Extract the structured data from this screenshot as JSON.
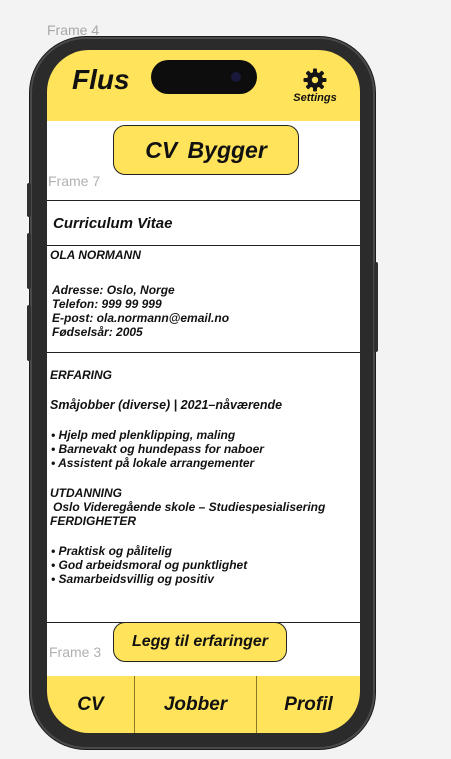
{
  "canvas": {
    "frame_top": "Frame 4"
  },
  "app": {
    "title": "Flus",
    "settings_label": "Settings"
  },
  "main": {
    "cv_button": "CV  Bygger",
    "frame_inner": "Frame 7",
    "frame_bottom": "Frame 3",
    "add_button": "Legg til erfaringer"
  },
  "cv": {
    "heading": "Curriculum Vitae",
    "name": "OLA NORMANN",
    "personal": [
      "Adresse: Oslo, Norge",
      "Telefon: 999 99 999",
      "E-post: ola.normann@email.no",
      "Fødselsår: 2005"
    ],
    "experience_label": "ERFARING",
    "job": "Småjobber (diverse) | 2021–nåværende",
    "job_bullets": [
      "• Hjelp med plenklipping, maling",
      "• Barnevakt og hundepass for naboer",
      "• Assistent på lokale arrangementer"
    ],
    "education_label": "UTDANNING",
    "school": "Oslo Videregående skole – Studiespesialisering",
    "skills_label": "FERDIGHETER",
    "skill_bullets": [
      "• Praktisk og pålitelig",
      "• God arbeidsmoral og punktlighet",
      "• Samarbeidsvillig og positiv"
    ]
  },
  "nav": {
    "items": [
      "CV",
      "Jobber",
      "Profil"
    ]
  },
  "colors": {
    "accent": "#ffe35a",
    "phone_body": "#2b2b2b",
    "canvas": "#f3f3f3"
  },
  "icons": {
    "settings": "gear-icon"
  }
}
